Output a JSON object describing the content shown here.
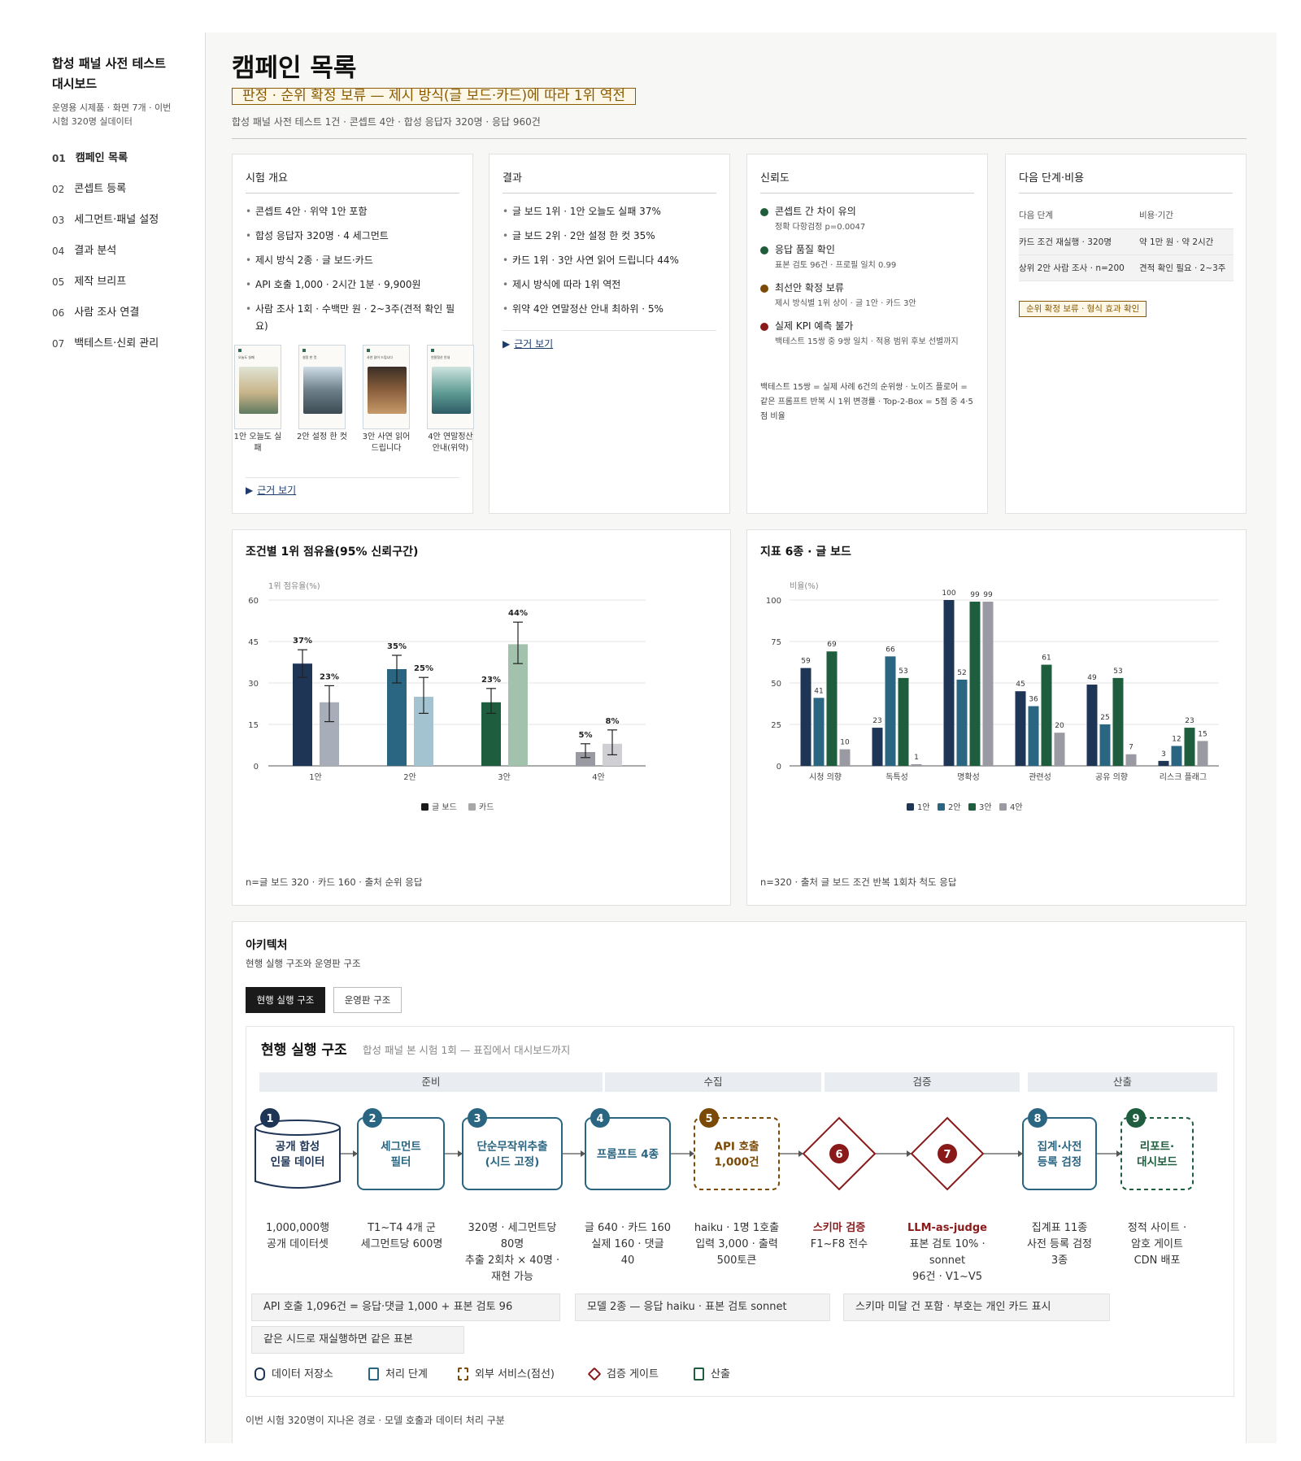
{
  "sidebar": {
    "title_line1": "합성 패널 사전 테스트",
    "title_line2": "대시보드",
    "subtitle_line1": "운영용 시제품 · 화면 7개 · 이번",
    "subtitle_line2": "시험 320명 실데이터",
    "items": [
      {
        "num": "01",
        "label": "캠페인 목록"
      },
      {
        "num": "02",
        "label": "콘셉트 등록"
      },
      {
        "num": "03",
        "label": "세그먼트·패널 설정"
      },
      {
        "num": "04",
        "label": "결과 분석"
      },
      {
        "num": "05",
        "label": "제작 브리프"
      },
      {
        "num": "06",
        "label": "사람 조사 연결"
      },
      {
        "num": "07",
        "label": "백테스트·신뢰 관리"
      }
    ]
  },
  "header": {
    "title": "캠페인 목록",
    "verdict": "판정 · 순위 확정 보류 — 제시 방식(글 보드·카드)에 따라 1위 역전",
    "summary": "합성 패널 사전 테스트 1건 · 콘셉트 4안 · 합성 응답자 320명 · 응답 960건"
  },
  "overview": {
    "title": "시험 개요",
    "bullets": [
      "콘셉트 4안 · 위약 1안 포함",
      "합성 응답자 320명 · 4 세그먼트",
      "제시 방식 2종 · 글 보드·카드",
      "API 호출 1,000 · 2시간 1분 · 9,900원",
      "사람 조사 1회 · 수백만 원 · 2~3주(견적 확인 필요)"
    ],
    "thumbs": [
      {
        "title": "오늘도 실패",
        "caption": "1안 오늘도 실패"
      },
      {
        "title": "설정 한 컷",
        "caption": "2안 설정 한 컷"
      },
      {
        "title": "사연 읽어 드립니다",
        "caption": "3안 사연 읽어 드립니다"
      },
      {
        "title": "연말정산 안내",
        "caption": "4안 연말정산 안내(위약)"
      }
    ],
    "evidence": "근거 보기"
  },
  "result": {
    "title": "결과",
    "bullets": [
      "글 보드 1위 · 1안 오늘도 실패 37%",
      "글 보드 2위 · 2안 설정 한 컷 35%",
      "카드 1위 · 3안 사연 읽어 드립니다 44%",
      "제시 방식에 따라 1위 역전",
      "위약 4안 연말정산 안내 최하위 · 5%"
    ],
    "evidence": "근거 보기"
  },
  "reliability": {
    "title": "신뢰도",
    "items": [
      {
        "head": "콘셉트 간 차이 유의",
        "sub": "정확 다항검정 p=0.0047",
        "color": "#1f5c3a"
      },
      {
        "head": "응답 품질 확인",
        "sub": "표본 검토 96건 · 프로필 일치 0.99",
        "color": "#1f5c3a"
      },
      {
        "head": "최선안 확정 보류",
        "sub": "제시 방식별 1위 상이 · 글 1안 · 카드 3안",
        "color": "#7a4a06"
      },
      {
        "head": "실제 KPI 예측 불가",
        "sub": "백테스트 15쌍 중 9쌍 일치 · 적용 범위 후보 선별까지",
        "color": "#8a1a1a"
      }
    ],
    "note": "백테스트 15쌍 = 실제 사례 6건의 순위쌍 · 노이즈 플로어 = 같은 프롬프트 반복 시 1위 변경률 · Top-2-Box = 5점 중 4·5점 비율"
  },
  "next": {
    "title": "다음 단계·비용",
    "col1": "다음 단계",
    "col2": "비용·기간",
    "rows": [
      {
        "step": "카드 조건 재실행 · 320명",
        "cost": "약 1만 원 · 약 2시간"
      },
      {
        "step": "상위 2안 사람 조사 · n=200",
        "cost": "견적 확인 필요 · 2~3주"
      }
    ],
    "badge": "순위 확정 보류 · 형식 효과 확인"
  },
  "share_chart": {
    "title": "조건별 1위 점유율(95% 신뢰구간)",
    "footnote": "n=글 보드 320 · 카드 160 · 출처 순위 응답"
  },
  "metric_chart": {
    "title": "지표 6종 · 글 보드",
    "footnote": "n=320 · 출처 글 보드 조건 반복 1회차 척도 응답"
  },
  "chart_data": [
    {
      "type": "bar",
      "title": "조건별 1위 점유율(95% 신뢰구간)",
      "ylabel": "1위 점유율(%)",
      "xlabel": "",
      "ylim": [
        0,
        60
      ],
      "yticks": [
        0,
        15,
        30,
        45,
        60
      ],
      "categories": [
        "1안",
        "2안",
        "3안",
        "4안"
      ],
      "series": [
        {
          "name": "글 보드",
          "values": [
            37,
            35,
            23,
            5
          ],
          "ci_low": [
            32,
            30,
            19,
            3
          ],
          "ci_high": [
            42,
            40,
            28,
            8
          ],
          "colors": [
            "#1f3556",
            "#2a6581",
            "#1e5e3e",
            "#9a9aa3"
          ]
        },
        {
          "name": "카드",
          "values": [
            23,
            25,
            44,
            8
          ],
          "ci_low": [
            16,
            19,
            37,
            4
          ],
          "ci_high": [
            29,
            32,
            52,
            13
          ],
          "colors": [
            "#a7adb9",
            "#a3c3d1",
            "#a3c2ad",
            "#cfcfd4"
          ]
        }
      ],
      "legend": "bottom",
      "grid": true
    },
    {
      "type": "bar",
      "title": "지표 6종 · 글 보드",
      "ylabel": "비율(%)",
      "xlabel": "",
      "ylim": [
        0,
        100
      ],
      "yticks": [
        0,
        25,
        50,
        75,
        100
      ],
      "categories": [
        "시청 의향",
        "독특성",
        "명확성",
        "관련성",
        "공유 의향",
        "리스크 플래그"
      ],
      "series": [
        {
          "name": "1안",
          "values": [
            59,
            23,
            100,
            45,
            49,
            3
          ],
          "color": "#1f3556"
        },
        {
          "name": "2안",
          "values": [
            41,
            66,
            52,
            36,
            25,
            12
          ],
          "color": "#2a6581"
        },
        {
          "name": "3안",
          "values": [
            69,
            53,
            99,
            61,
            53,
            23
          ],
          "color": "#1e5e3e"
        },
        {
          "name": "4안",
          "values": [
            10,
            1,
            99,
            20,
            7,
            15
          ],
          "color": "#9a9aa3"
        }
      ],
      "legend": "bottom",
      "grid": true
    }
  ],
  "architecture": {
    "title": "아키텍처",
    "subtitle": "현행 실행 구조와 운영판 구조",
    "tabs": [
      "현행 실행 구조",
      "운영판 구조"
    ],
    "inner_title": "현행 실행 구조",
    "inner_subtitle": "합성 패널 본 시험 1회 — 표집에서 대시보드까지",
    "phases": [
      "준비",
      "수집",
      "검증",
      "산출"
    ],
    "steps": [
      {
        "num": "1",
        "label_lines": [
          "공개 합성",
          "인물 데이터"
        ],
        "desc_lines": [
          "1,000,000행",
          "공개 데이터셋"
        ],
        "kind": "store"
      },
      {
        "num": "2",
        "label_lines": [
          "세그먼트",
          "필터"
        ],
        "desc_lines": [
          "T1~T4 4개 군",
          "세그먼트당 600명"
        ],
        "kind": "process"
      },
      {
        "num": "3",
        "label_lines": [
          "단순무작위추출",
          "(시드 고정)"
        ],
        "desc_lines": [
          "320명 · 세그먼트당",
          "80명",
          "추출 2회차 × 40명 ·",
          "재현 가능"
        ],
        "kind": "process"
      },
      {
        "num": "4",
        "label_lines": [
          "프롬프트 4종"
        ],
        "desc_lines": [
          "글 640 · 카드 160",
          "실제 160 · 댓글",
          "40"
        ],
        "kind": "process"
      },
      {
        "num": "5",
        "label_lines": [
          "API 호출",
          "1,000건"
        ],
        "desc_lines": [
          "haiku · 1명 1호출",
          "입력 3,000 · 출력",
          "500토큰"
        ],
        "kind": "external"
      },
      {
        "num": "6",
        "label_lines": [
          "스키마 검증"
        ],
        "desc_lines": [
          "F1~F8 전수"
        ],
        "kind": "gate"
      },
      {
        "num": "7",
        "label_lines": [
          "LLM-as-judge"
        ],
        "desc_lines": [
          "표본 검토 10% ·",
          "sonnet",
          "96건 · V1~V5"
        ],
        "kind": "gate"
      },
      {
        "num": "8",
        "label_lines": [
          "집계·사전",
          "등록 검정"
        ],
        "desc_lines": [
          "집계표 11종",
          "사전 등록 검정",
          "3종"
        ],
        "kind": "process"
      },
      {
        "num": "9",
        "label_lines": [
          "리포트·",
          "대시보드"
        ],
        "desc_lines": [
          "정적 사이트 ·",
          "암호 게이트",
          "CDN 배포"
        ],
        "kind": "output"
      }
    ],
    "notes": [
      "API 호출 1,096건 = 응답·댓글 1,000 + 표본 검토 96",
      "모델 2종 — 응답 haiku · 표본 검토 sonnet",
      "스키마 미달 건 포함 · 부호는 개인 카드 표시",
      "같은 시드로 재실행하면 같은 표본"
    ],
    "legend": [
      "데이터 저장소",
      "처리 단계",
      "외부 서비스(점선)",
      "검증 게이트",
      "산출"
    ],
    "footnote": "이번 시험 320명이 지나온 경로 · 모델 호출과 데이터 처리 구분"
  },
  "colors": {
    "navy": "#1f3556",
    "teal": "#2a6581",
    "green": "#1e5e3e",
    "brown": "#7a4a06",
    "red": "#8a1a1a",
    "gray": "#9a9aa3"
  }
}
